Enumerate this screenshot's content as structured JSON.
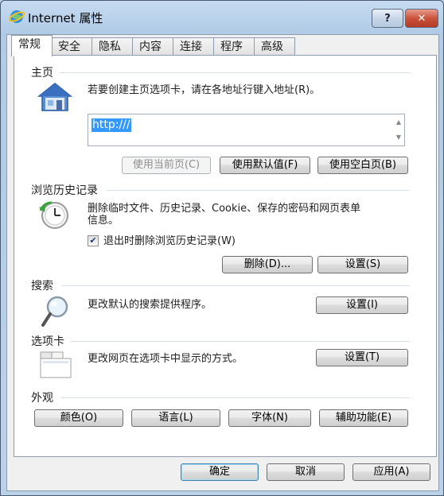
{
  "window": {
    "title": "Internet 属性",
    "help": "?",
    "close": "✕"
  },
  "tabs": [
    "常规",
    "安全",
    "隐私",
    "内容",
    "连接",
    "程序",
    "高级"
  ],
  "home": {
    "section": "主页",
    "instruction": "若要创建主页选项卡，请在各地址行键入地址(R)。",
    "url_value": "http:///",
    "btn_current": "使用当前页(C)",
    "btn_default": "使用默认值(F)",
    "btn_blank": "使用空白页(B)"
  },
  "history": {
    "section": "浏览历史记录",
    "desc_line1": "删除临时文件、历史记录、Cookie、保存的密码和网页表单",
    "desc_line2": "信息。",
    "checkbox_label": "退出时删除浏览历史记录(W)",
    "checked": true,
    "btn_delete": "删除(D)...",
    "btn_settings": "设置(S)"
  },
  "search": {
    "section": "搜索",
    "desc": "更改默认的搜索提供程序。",
    "btn_settings": "设置(I)"
  },
  "tabsec": {
    "section": "选项卡",
    "desc": "更改网页在选项卡中显示的方式。",
    "btn_settings": "设置(T)"
  },
  "appearance": {
    "section": "外观",
    "btn_colors": "颜色(O)",
    "btn_languages": "语言(L)",
    "btn_fonts": "字体(N)",
    "btn_accessibility": "辅助功能(E)"
  },
  "footer": {
    "ok": "确定",
    "cancel": "取消",
    "apply": "应用(A)"
  },
  "colors": {
    "accent": "#3399ff",
    "window_frame": "#b9d1ea"
  },
  "icons": [
    "ie-globe-icon",
    "home-icon",
    "history-clock-icon",
    "magnifier-icon",
    "tabs-icon",
    "checkmark-icon",
    "scroll-up-icon",
    "scroll-down-icon"
  ]
}
